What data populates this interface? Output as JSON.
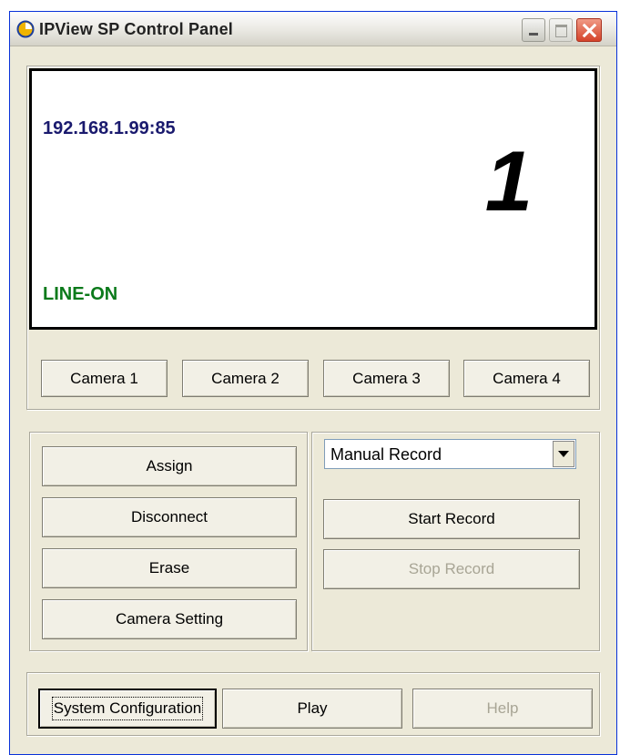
{
  "window": {
    "title": "IPView SP Control Panel"
  },
  "video": {
    "address": "192.168.1.99:85",
    "camera_number": "1",
    "line_status": "LINE-ON"
  },
  "camera_buttons": [
    "Camera 1",
    "Camera 2",
    "Camera 3",
    "Camera 4"
  ],
  "actions": {
    "assign": "Assign",
    "disconnect": "Disconnect",
    "erase": "Erase",
    "camera_setting": "Camera Setting"
  },
  "record": {
    "mode_selected": "Manual Record",
    "start": "Start Record",
    "stop": "Stop Record"
  },
  "footer": {
    "system_configuration": "System Configuration",
    "play": "Play",
    "help": "Help"
  },
  "colors": {
    "address_text": "#1a1a6e",
    "status_text": "#0b7a1b",
    "window_bg": "#ece9d8"
  }
}
